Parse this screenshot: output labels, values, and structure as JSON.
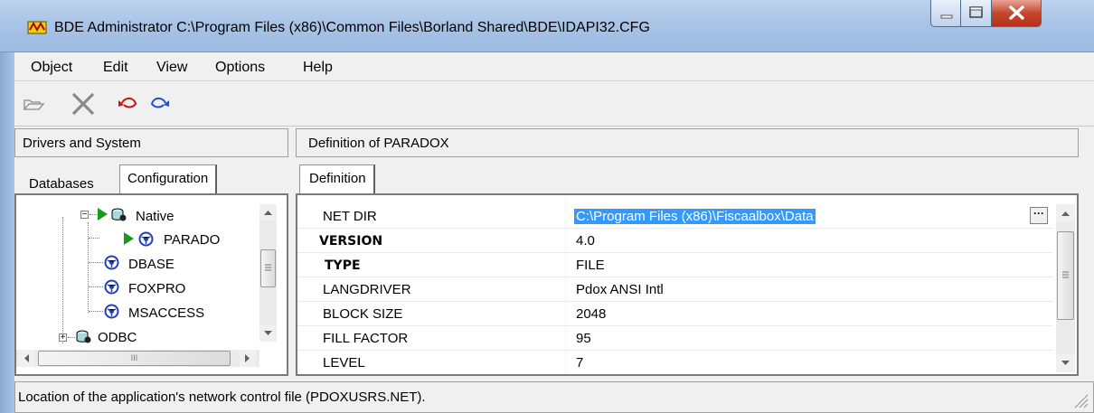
{
  "window": {
    "title": "BDE Administrator  C:\\Program Files (x86)\\Common Files\\Borland Shared\\BDE\\IDAPI32.CFG",
    "controls": [
      "minimize-icon",
      "maximize-icon",
      "close-icon"
    ]
  },
  "menu": {
    "object": "Object",
    "edit": "Edit",
    "view": "View",
    "options": "Options",
    "help": "Help"
  },
  "toolbar": {
    "icons": [
      "open-folder-icon",
      "delete-x-icon",
      "undo-icon",
      "redo-icon"
    ]
  },
  "left_panel": {
    "header": "Drivers and System",
    "tabs": {
      "databases": "Databases",
      "configuration": "Configuration"
    },
    "tree": {
      "native": "Native",
      "paradox": "PARADO",
      "dbase": "DBASE",
      "foxpro": "FOXPRO",
      "msaccess": "MSACCESS",
      "odbc": "ODBC"
    },
    "hscroll_grip": "III"
  },
  "right_panel": {
    "header": "Definition of PARADOX",
    "tab": "Definition",
    "rows": [
      {
        "name": "NET DIR",
        "value": "C:\\Program Files (x86)\\Fiscaalbox\\Data"
      },
      {
        "name": "VERSION",
        "value": "4.0"
      },
      {
        "name": "TYPE",
        "value": "FILE"
      },
      {
        "name": "LANGDRIVER",
        "value": "Pdox ANSI Intl"
      },
      {
        "name": "BLOCK SIZE",
        "value": "2048"
      },
      {
        "name": "FILL FACTOR",
        "value": "95"
      },
      {
        "name": "LEVEL",
        "value": "7"
      }
    ],
    "ellipsis_button": "···"
  },
  "status": {
    "text": "Location of the application's network control file (PDOXUSRS.NET)."
  },
  "colors": {
    "selection": "#3399ff",
    "play_arrow": "#1a9a1a",
    "driver_icon": "#1f3fbf",
    "undo_redo": "#d01010"
  }
}
